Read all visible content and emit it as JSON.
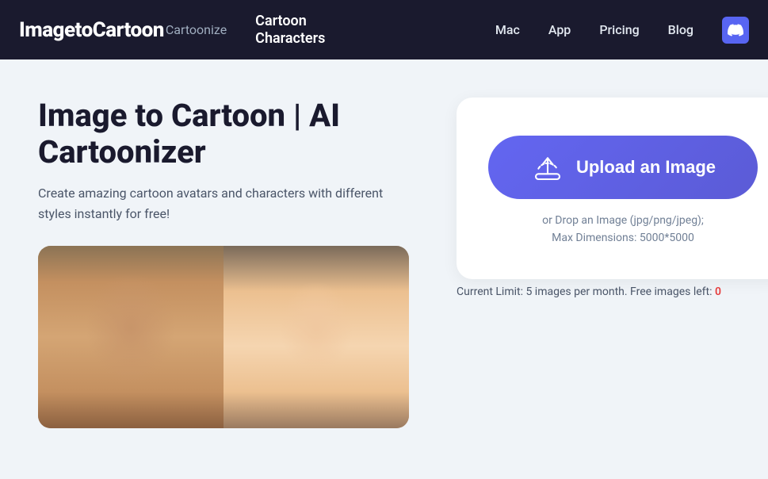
{
  "brand": {
    "main": "ImagetoCartoon",
    "sub": "Cartoonize"
  },
  "nav_center": {
    "line1": "Cartoon",
    "line2": "Characters"
  },
  "nav_links": [
    {
      "label": "Mac",
      "name": "nav-mac"
    },
    {
      "label": "App",
      "name": "nav-app"
    },
    {
      "label": "Pricing",
      "name": "nav-pricing"
    },
    {
      "label": "Blog",
      "name": "nav-blog"
    }
  ],
  "page": {
    "title": "Image to Cartoon | AI Cartoonizer",
    "subtitle": "Create amazing cartoon avatars and characters with different styles instantly for free!",
    "upload_button_label": "Upload an Image",
    "drop_text_line1": "or Drop an Image (jpg/png/jpeg);",
    "drop_text_line2": "Max Dimensions: 5000*5000",
    "limit_text": "Current Limit: 5 images per month. Free images left:",
    "limit_number": "0"
  },
  "colors": {
    "navbar_bg": "#1a1a2e",
    "upload_btn_bg": "#5b5bd6",
    "limit_number_color": "#e53e3e"
  }
}
